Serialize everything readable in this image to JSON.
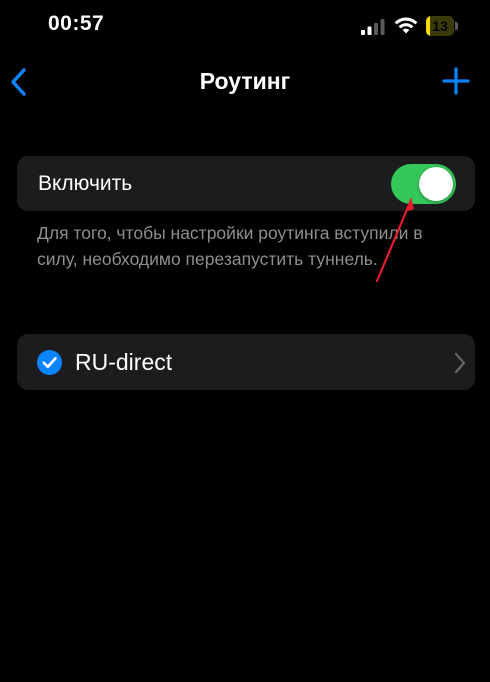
{
  "status_bar": {
    "time": "00:57",
    "battery_level": "13",
    "battery_fraction": 0.13,
    "icons": [
      "cellular-signal-icon",
      "wifi-icon",
      "battery-icon"
    ]
  },
  "nav": {
    "title": "Роутинг",
    "back_icon": "chevron-left-icon",
    "add_icon": "plus-icon"
  },
  "routing_toggle": {
    "label": "Включить",
    "enabled": true
  },
  "footnote": "Для того, чтобы настройки роутинга вступили в силу, необходимо перезапустить туннель.",
  "routes": [
    {
      "label": "RU-direct",
      "selected": true,
      "icon": "checkmark-circle-icon"
    }
  ],
  "colors": {
    "background": "#000000",
    "cell": "#1c1c1e",
    "accent": "#0a84ff",
    "switch_on": "#34c759",
    "secondary_text": "#8e8e93",
    "annotation_arrow": "#e5202a",
    "battery_low": "#f5d90a"
  }
}
